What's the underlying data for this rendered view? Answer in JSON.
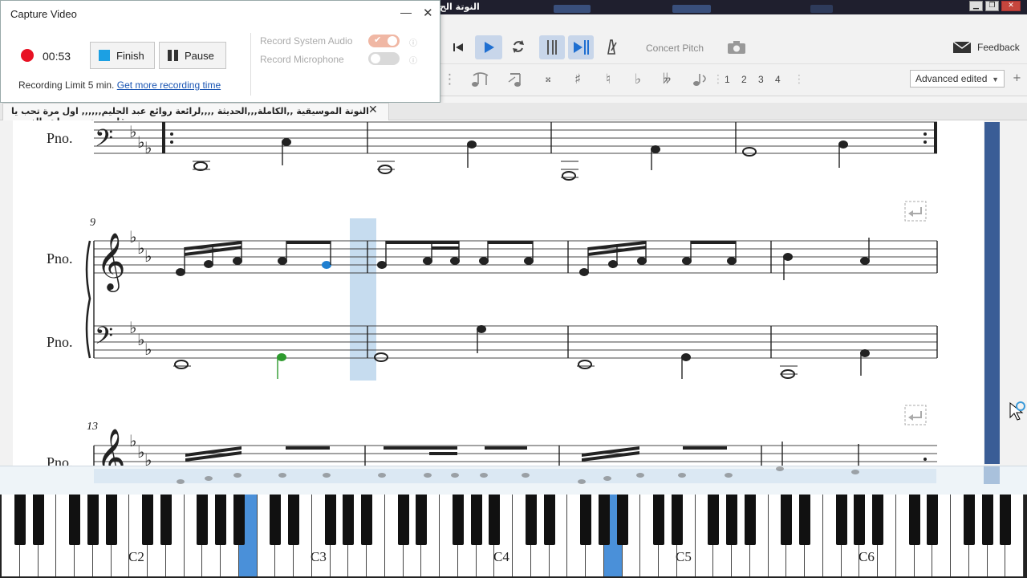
{
  "window": {
    "title": "النوتة الح",
    "colors": {
      "accent": "#4a90d9",
      "record": "#e81123",
      "scrollbar": "#3a5d96"
    }
  },
  "capture_dialog": {
    "title": "Capture Video",
    "minimize_label": "—",
    "close_label": "✕",
    "timer": "00:53",
    "finish_label": "Finish",
    "pause_label": "Pause",
    "limit_text": "Recording Limit 5 min.",
    "limit_link": "Get more recording time",
    "system_audio_label": "Record System Audio",
    "system_audio_on": true,
    "microphone_label": "Record Microphone",
    "microphone_on": false
  },
  "toolbar": {
    "concert_pitch": "Concert Pitch",
    "feedback": "Feedback",
    "voices": [
      "1",
      "2",
      "3",
      "4"
    ],
    "workspace": "Advanced edited",
    "accidental_symbols": [
      "♯",
      "♮",
      "♭",
      "𝄫"
    ],
    "double_sharp": "𝄪"
  },
  "tab": {
    "title": "النوتة الموسيقية ,,الكاملة,,,الحديثة ,,,,لرائعة روائع عبد الحليم,,,,,, اول مرة تحب يا قلبي,,,تدوين ماهر الغمرى",
    "close": "✕"
  },
  "score": {
    "instrument": "Pno.",
    "measure_numbers": [
      "9",
      "13"
    ]
  },
  "piano": {
    "labels": [
      "C2",
      "C3",
      "C4",
      "C5",
      "C6"
    ]
  }
}
